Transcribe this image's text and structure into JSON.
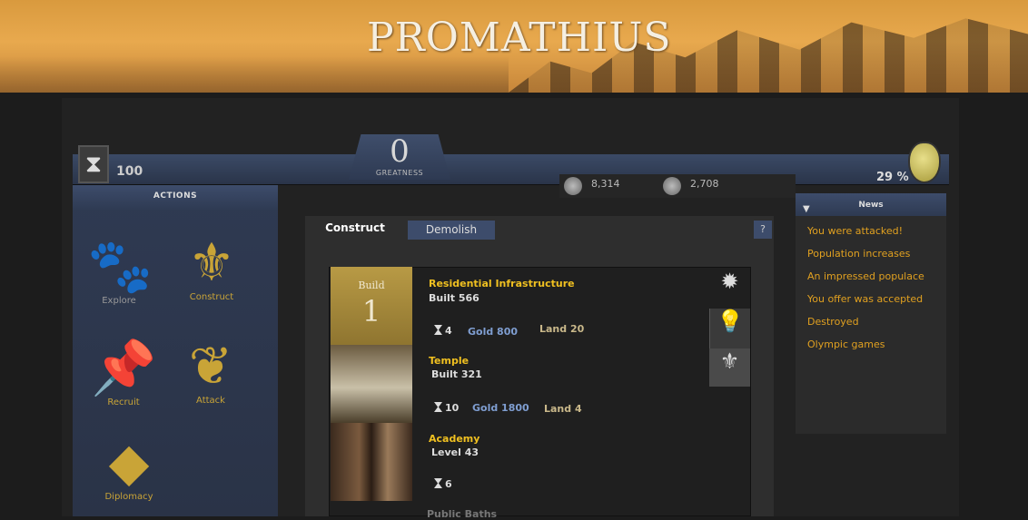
{
  "header": {
    "logo_text": "PROMATHIUS"
  },
  "status": {
    "turns": "100",
    "greatness_value": "0",
    "greatness_label": "GREATNESS",
    "population": "8,314",
    "gold": "2,708",
    "happiness": "29 %"
  },
  "actions": {
    "title": "ACTIONS",
    "items": [
      {
        "label": "Explore",
        "icon": "paw-icon"
      },
      {
        "label": "Construct",
        "icon": "fleur-de-lis-icon"
      },
      {
        "label": "Recruit",
        "icon": "pushpin-icon"
      },
      {
        "label": "Attack",
        "icon": "attack-icon"
      },
      {
        "label": "Diplomacy",
        "icon": "scroll-icon"
      }
    ]
  },
  "tabs": {
    "construct": "Construct",
    "demolish": "Demolish",
    "help": "?"
  },
  "buildings": [
    {
      "name": "Residential Infrastructure",
      "sub": "Built 566",
      "turns": "4",
      "gold": "Gold 800",
      "land": "Land 20",
      "build_label": "Build",
      "build_count": "1"
    },
    {
      "name": "Temple",
      "sub": "Built 321",
      "turns": "10",
      "gold": "Gold 1800",
      "land": "Land 4"
    },
    {
      "name": "Academy",
      "sub": "Level 43",
      "turns": "6"
    }
  ],
  "cut_off_row": "Public Baths",
  "news": {
    "title": "News",
    "items": [
      "You were attacked!",
      "Population increases",
      "An impressed populace",
      "You offer was accepted",
      "Destroyed",
      "Olympic games"
    ]
  }
}
